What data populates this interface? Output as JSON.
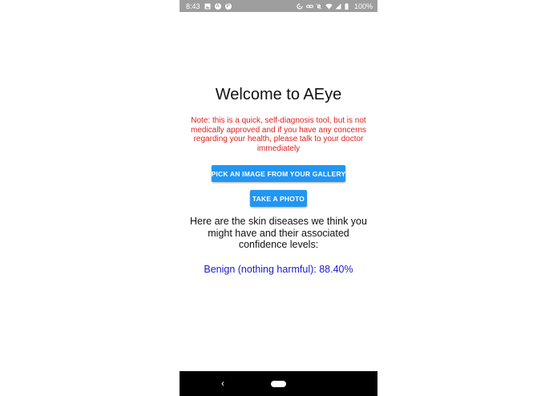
{
  "status_bar": {
    "time": "8:43",
    "left_icons": [
      "image-icon",
      "a-circle-icon",
      "p-circle-icon"
    ],
    "a_badge": "A",
    "p_badge": "P",
    "right_icons": [
      "data-saver-icon",
      "link-icon",
      "notifications-off-icon",
      "wifi-icon",
      "cell-signal-icon",
      "battery-icon"
    ],
    "battery": "100%"
  },
  "main": {
    "title": "Welcome to AEye",
    "note": "Note: this is a quick, self-diagnosis tool, but is not medically approved and if you have any concerns regarding your health, please talk to your doctor immediately",
    "gallery_button": "PICK AN IMAGE FROM YOUR GALLERY",
    "photo_button": "TAKE A PHOTO",
    "results_heading": "Here are the skin diseases we think you might have and their associated confidence levels:",
    "results": [
      {
        "label": "Benign (nothing harmful): 88.40%"
      }
    ]
  },
  "nav_bar": {
    "back_glyph": "‹"
  },
  "colors": {
    "status_bar_bg": "#9e9e9e",
    "note_text": "#e0201f",
    "button_bg": "#2196f3",
    "result_text": "#1a1acd",
    "nav_bar_bg": "#000000"
  }
}
